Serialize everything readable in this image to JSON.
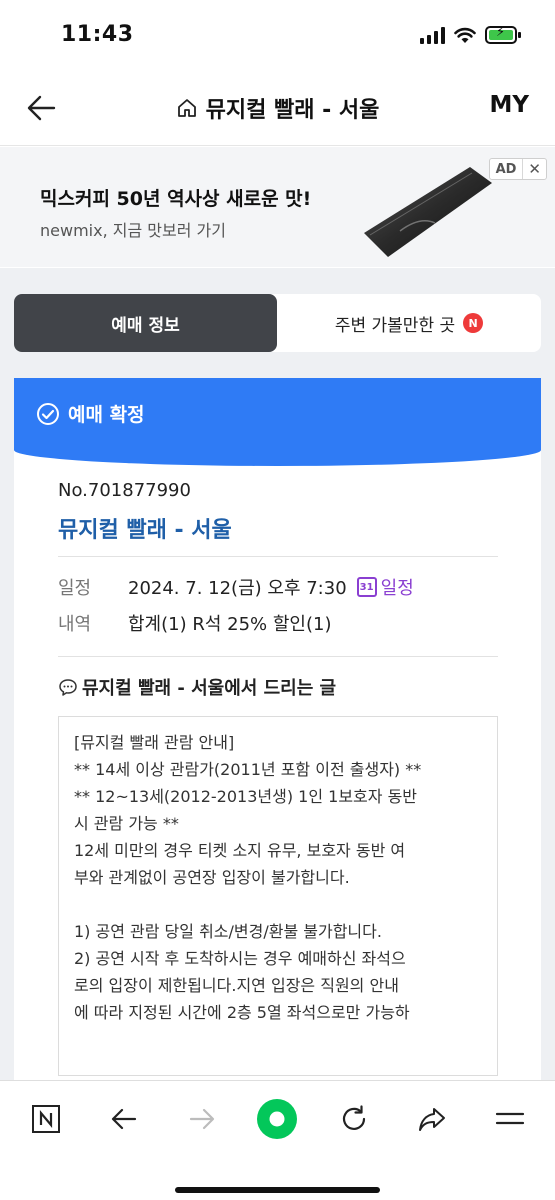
{
  "status": {
    "time": "11:43"
  },
  "header": {
    "title": "뮤지컬 빨래 - 서울",
    "my_label": "MY"
  },
  "ad": {
    "title": "믹스커피 50년 역사상 새로운 맛!",
    "subtitle": "newmix, 지금 맛보러 가기",
    "badge": "AD",
    "close": "✕"
  },
  "tabs": {
    "active": "예매 정보",
    "inactive": "주변 가볼만한 곳",
    "new_badge": "N"
  },
  "booking": {
    "status": "예매 확정",
    "number": "No.701877990",
    "title": "뮤지컬 빨래 - 서울",
    "schedule_label": "일정",
    "schedule_value": "2024. 7. 12(금) 오후 7:30",
    "calendar_link": "일정",
    "calendar_day": "31",
    "details_label": "내역",
    "details_value": "합계(1) R석 25% 할인(1)"
  },
  "message": {
    "title": "뮤지컬 빨래 - 서울에서 드리는 글",
    "lines": [
      "[뮤지컬 빨래 관람 안내]",
      "** 14세 이상 관람가(2011년 포함 이전 출생자) **",
      "** 12~13세(2012-2013년생) 1인 1보호자 동반",
      "시 관람 가능 **",
      "12세 미만의 경우 티켓 소지 유무, 보호자 동반 여",
      "부와 관계없이 공연장 입장이 불가합니다.",
      "",
      "1) 공연 관람 당일 취소/변경/환불 불가합니다.",
      "2) 공연 시작 후 도착하시는 경우 예매하신 좌석으",
      "로의 입장이 제한됩니다.지연 입장은 직원의 안내",
      "에 따라 지정된 시간에 2층 5열 좌석으로만 가능하"
    ]
  },
  "toolbar": {
    "naver_label": "N"
  },
  "colors": {
    "accent": "#2f7bf5",
    "title_blue": "#1f5fa8",
    "calendar_purple": "#8a3fd1",
    "tab_dark": "#414449",
    "naver_green": "#03c75a"
  }
}
